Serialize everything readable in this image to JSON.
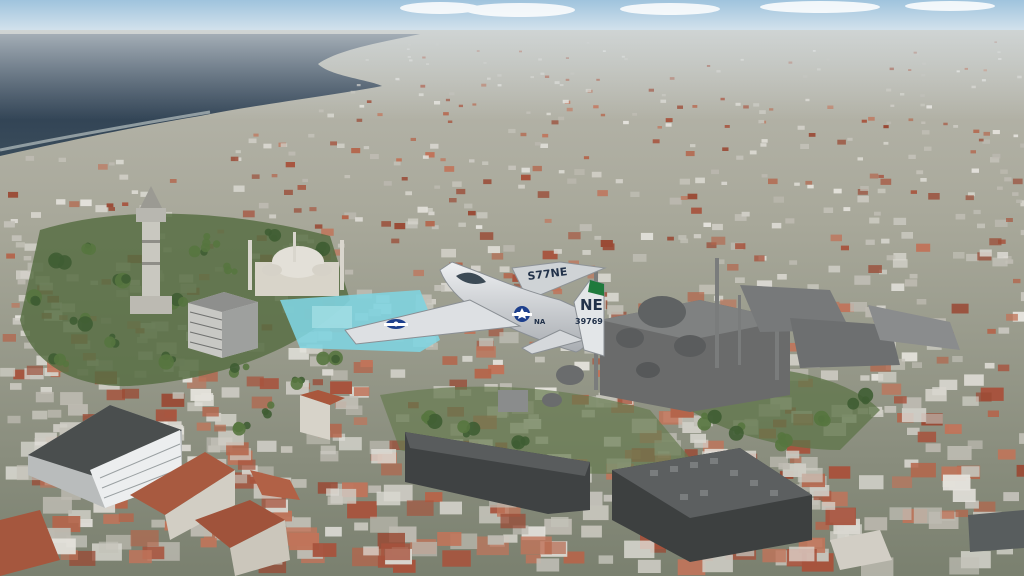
{
  "scene": {
    "description_hidden": "",
    "aircraft": {
      "fuselage_code": "S77NE",
      "tail_code": "NE",
      "serial": "39769",
      "wing_mark": "NA",
      "paint_color": "#d9dcdf",
      "tail_stripe_color": "#1f7a3c",
      "roundel_color": "#1d3f8c"
    },
    "colors": {
      "sky_top": "#9fc3dd",
      "sky_horizon": "#dfe8ee",
      "sea": "#2b3d4f",
      "roofs": "#a7533d",
      "buildings": "#d7d5cf",
      "greenery": "#4f6e3e",
      "pool": "#7fd3df",
      "dark_blocks": "#4d4f4f"
    }
  }
}
